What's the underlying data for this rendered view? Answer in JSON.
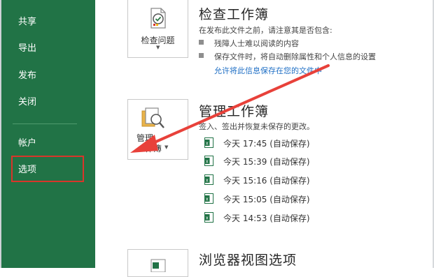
{
  "sidebar": {
    "items": [
      {
        "label": "共享"
      },
      {
        "label": "导出"
      },
      {
        "label": "发布"
      },
      {
        "label": "关闭"
      },
      {
        "label": "帐户"
      },
      {
        "label": "选项"
      }
    ]
  },
  "inspect": {
    "title": "检查工作簿",
    "button_label": "检查问题",
    "description": "在发布此文件之前，请注意其是否包含:",
    "bullets": [
      "残障人士难以阅读的内容",
      "保存文件时，将自动删除属性和个人信息的设置"
    ],
    "link": "允许将此信息保存在您的文件中"
  },
  "manage": {
    "title": "管理工作簿",
    "button_label_1": "管理",
    "button_label_2": "作簿",
    "description": "签入、签出并恢复未保存的更改。",
    "versions": [
      {
        "label": "今天 17:45 (自动保存)"
      },
      {
        "label": "今天 15:39 (自动保存)"
      },
      {
        "label": "今天 15:16 (自动保存)"
      },
      {
        "label": "今天 15:05 (自动保存)"
      },
      {
        "label": "今天 14:53 (自动保存)"
      }
    ]
  },
  "browser": {
    "title": "浏览器视图选项"
  },
  "colors": {
    "sidebar_bg": "#217346",
    "highlight_box": "#d9352a",
    "arrow": "#e8413a",
    "link": "#1f6fc5"
  }
}
